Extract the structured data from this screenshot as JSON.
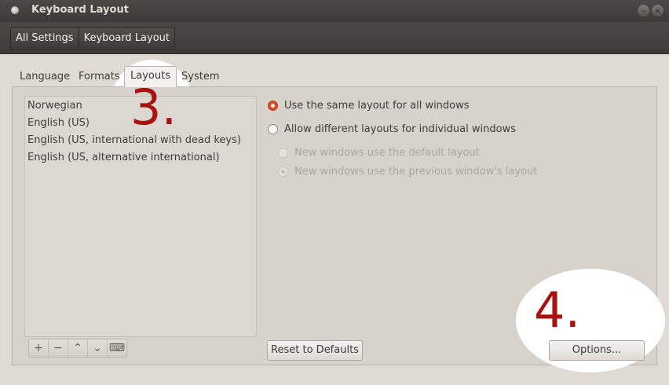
{
  "window": {
    "title": "Keyboard Layout",
    "close_glyph": "×",
    "min_glyph": "–"
  },
  "breadcrumb": [
    "All Settings",
    "Keyboard Layout"
  ],
  "tabs": [
    {
      "label": "Language"
    },
    {
      "label": "Formats"
    },
    {
      "label": "Layouts",
      "active": true
    },
    {
      "label": "System"
    }
  ],
  "layouts": [
    "Norwegian",
    "English (US)",
    "English (US, international with dead keys)",
    "English (US, alternative international)"
  ],
  "list_buttons": {
    "add": "+",
    "remove": "−",
    "up": "⌃",
    "down": "⌄",
    "keyboard": "⌨"
  },
  "options": {
    "same_layout": {
      "label": "Use the same layout for all windows",
      "checked": true
    },
    "different_layouts": {
      "label": "Allow different layouts for individual windows",
      "checked": false
    },
    "default_layout": {
      "label": "New windows use the default layout",
      "checked": false,
      "enabled": false
    },
    "previous_layout": {
      "label": "New windows use the previous window's layout",
      "checked": true,
      "enabled": false
    }
  },
  "buttons": {
    "reset": "Reset to Defaults",
    "options": "Options..."
  },
  "annotations": {
    "step3": "3.",
    "step4": "4."
  },
  "colors": {
    "accent": "#e05a34",
    "annotation": "#a91212"
  }
}
